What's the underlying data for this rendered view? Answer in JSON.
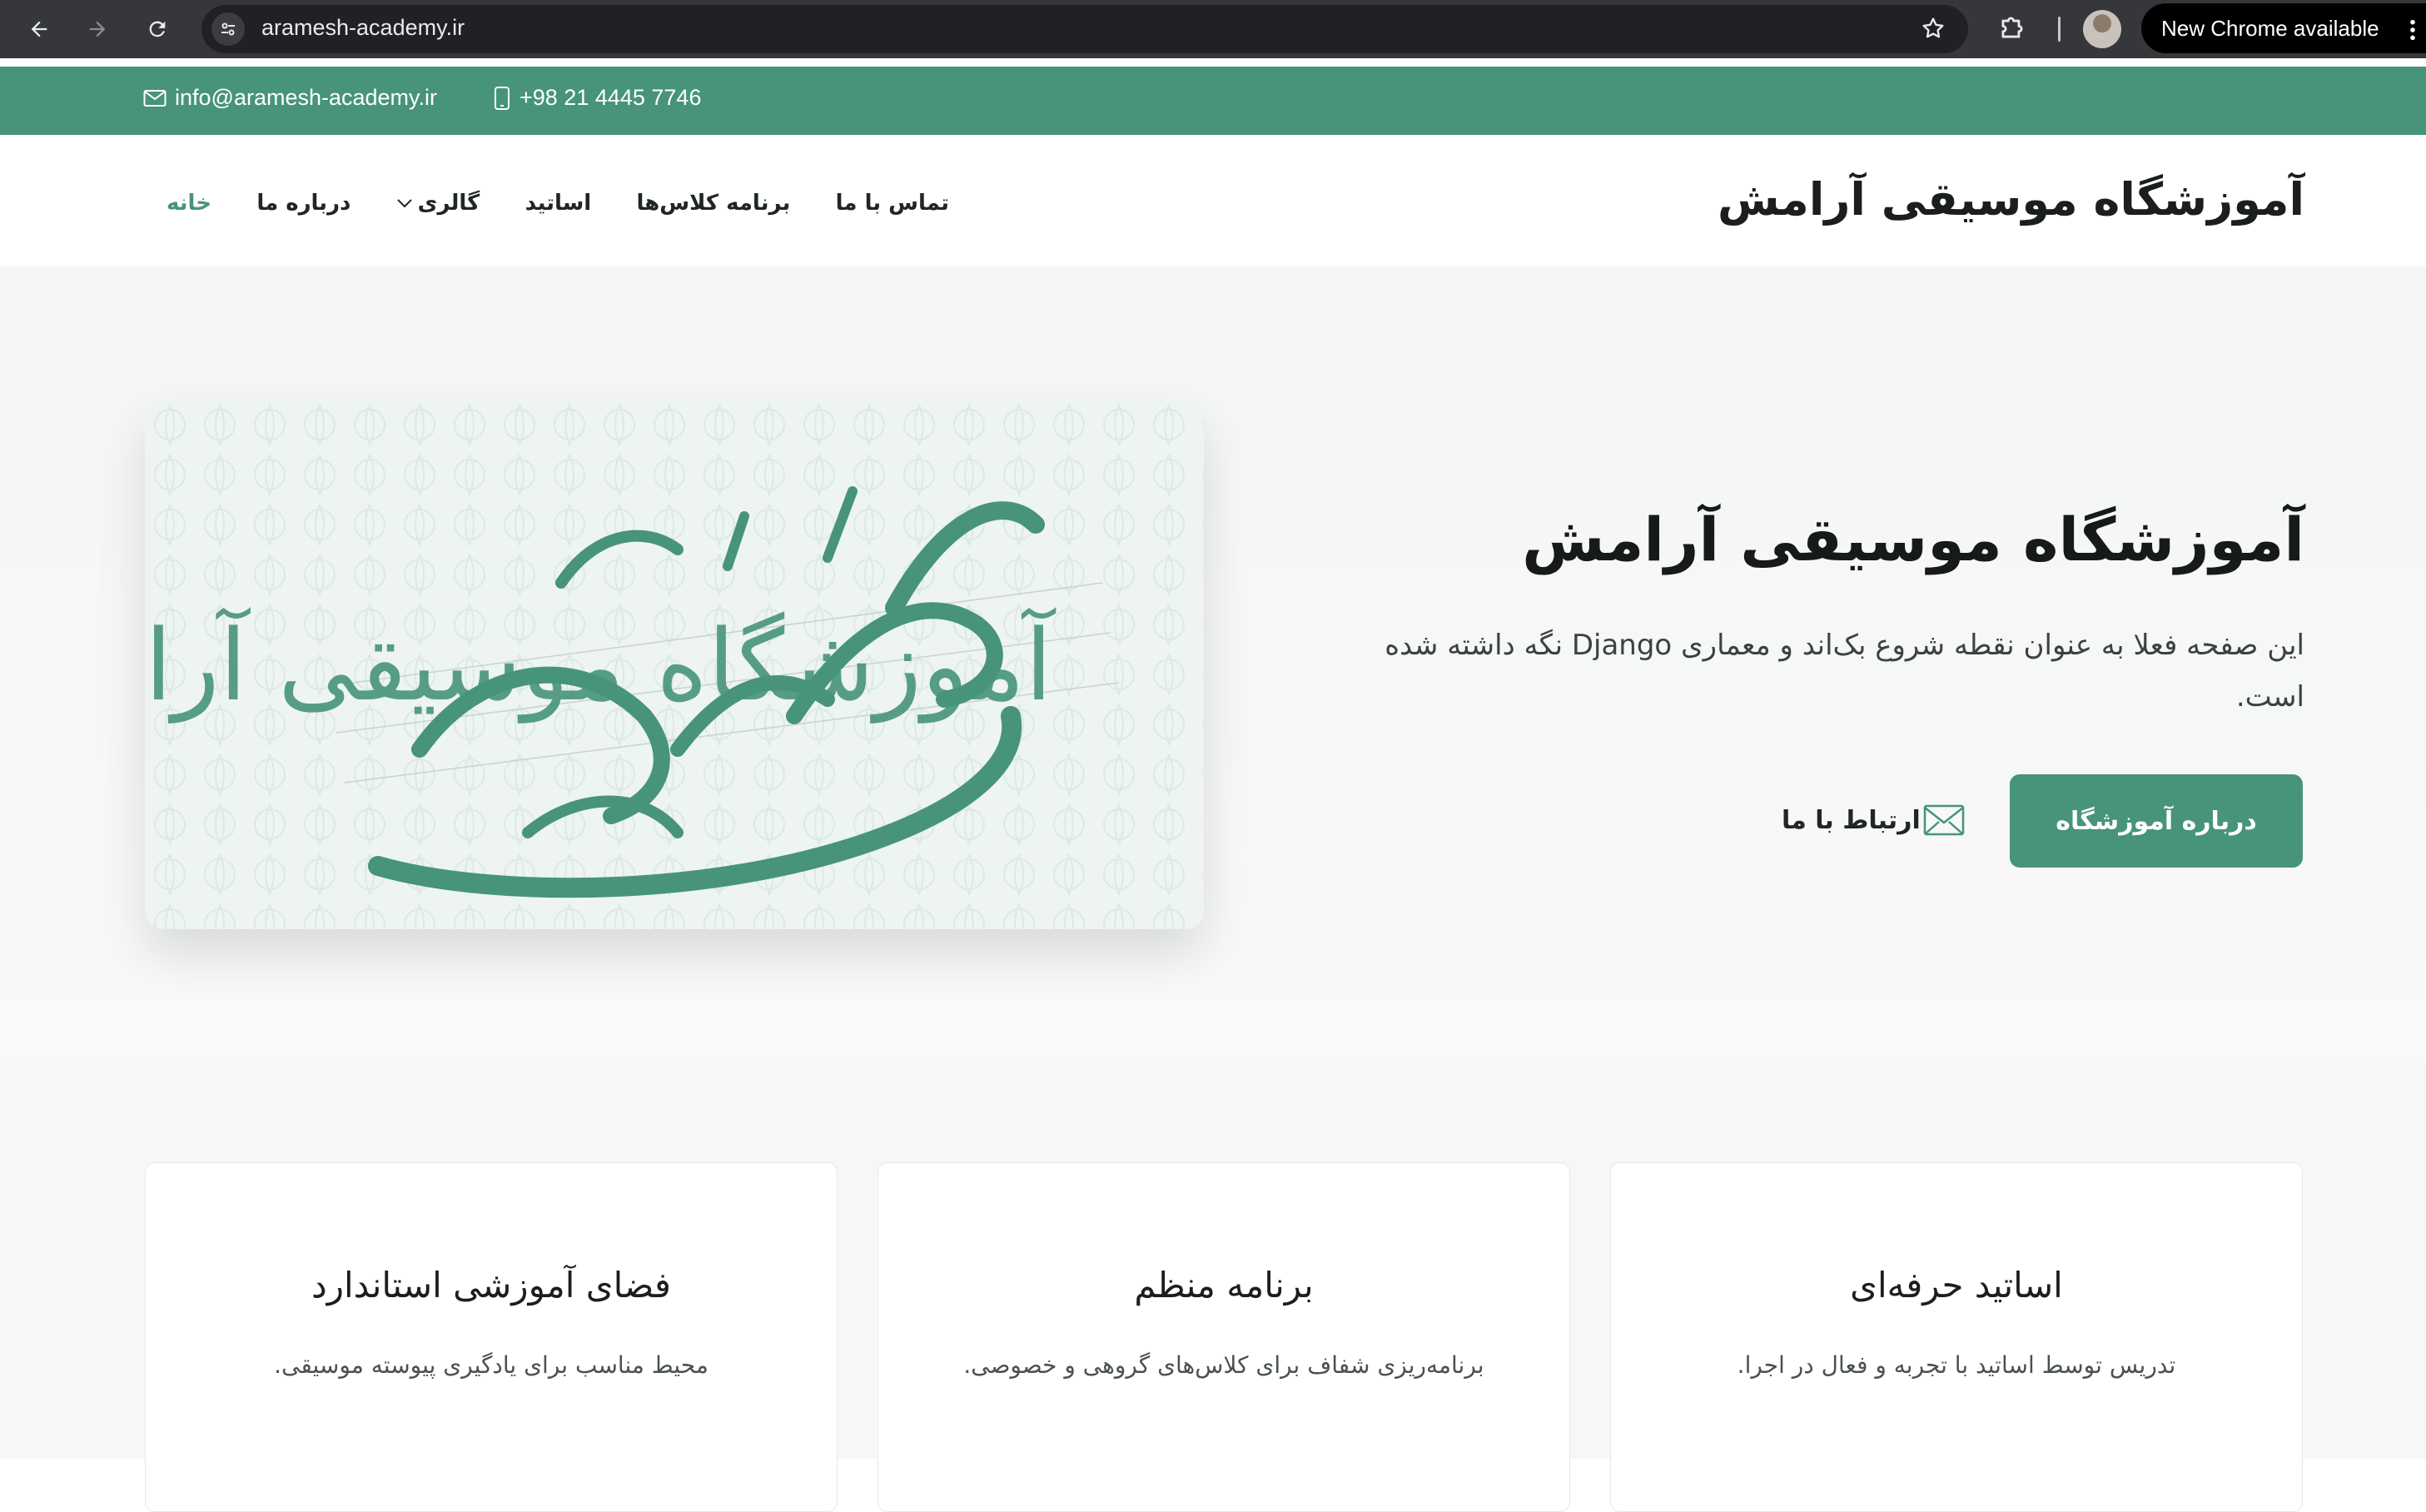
{
  "browser": {
    "url": "aramesh-academy.ir",
    "update_label": "New Chrome available"
  },
  "topbar": {
    "email": "info@aramesh-academy.ir",
    "phone": "+98 21 4445 7746"
  },
  "header": {
    "brand": "آموزشگاه موسیقی آرامش",
    "menu": [
      {
        "label": "خانه",
        "active": true
      },
      {
        "label": "درباره ما"
      },
      {
        "label": "گالری",
        "has_dropdown": true
      },
      {
        "label": "اساتید"
      },
      {
        "label": "برنامه کلاس‌ها"
      },
      {
        "label": "تماس با ما"
      }
    ]
  },
  "hero": {
    "title": "آموزشگاه موسیقی آرامش",
    "description": "این صفحه فعلا به عنوان نقطه شروع بک‌اند و معماری Django نگه داشته شده است.",
    "primary_button": "درباره آموزشگاه",
    "secondary_button": "ارتباط با ما",
    "image_calligraphy": "آموزشگاه موسیقی آرامش"
  },
  "features": [
    {
      "title": "اساتید حرفه‌ای",
      "text": "تدریس توسط اساتید با تجربه و فعال در اجرا."
    },
    {
      "title": "برنامه منظم",
      "text": "برنامه‌ریزی شفاف برای کلاس‌های گروهی و خصوصی."
    },
    {
      "title": "فضای آموزشی استاندارد",
      "text": "محیط مناسب برای یادگیری پیوسته موسیقی."
    }
  ],
  "colors": {
    "accent": "#47947b",
    "chrome_bg": "#35373a",
    "text_dark": "#1f2624"
  }
}
